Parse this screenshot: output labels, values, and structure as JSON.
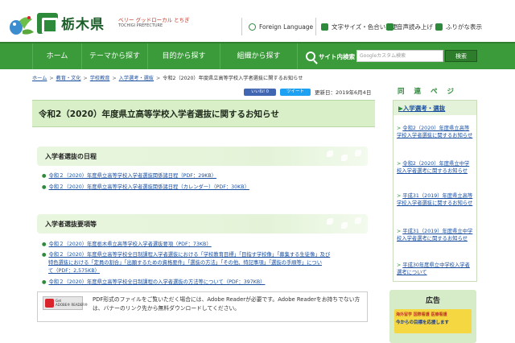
{
  "header": {
    "site_name": "栃木県",
    "tagline": "ベリー グッドローカル とちぎ",
    "tagline_en": "TOCHIGI PREFECTURE",
    "utility": [
      {
        "label": "Foreign Language",
        "icon": "globe-icon"
      },
      {
        "label": "文字サイズ・色合い変更",
        "icon": "text-size-icon"
      },
      {
        "label": "音声読み上げ",
        "icon": "speaker-icon"
      },
      {
        "label": "ふりがな表示",
        "icon": "furigana-icon"
      }
    ]
  },
  "nav": {
    "items": [
      "ホーム",
      "テーマから探す",
      "目的から探す",
      "組織から探す"
    ],
    "search_label": "サイト内検索",
    "search_placeholder": "Googleカスタム検索",
    "search_button": "検索"
  },
  "breadcrumb": [
    "ホーム",
    "教育・文化",
    "学校教育",
    "入学選考・選抜",
    "令和2（2020）年度県立高等学校入学者選抜に関するお知らせ"
  ],
  "share": {
    "like": "いいね! 0",
    "tweet": "ツイート"
  },
  "updated": "更新日：2019年6月4日",
  "page_title": "令和2（2020）年度県立高等学校入学者選抜に関するお知らせ",
  "sections": [
    {
      "heading": "入学者選抜の日程",
      "links": [
        "令和２（2020）年度県立高等学校入学者選抜関係諸日程（PDF：29KB）",
        "令和２（2020）年度県立高等学校入学者選抜関係諸日程（カレンダー）（PDF：30KB）"
      ]
    },
    {
      "heading": "入学者選抜要項等",
      "links": [
        "令和２（2020）年度栃木県立高等学校入学者選抜要項（PDF：73KB）",
        "令和２（2020）年度県立高等学校全日制課程入学者選抜における「学校教育目標」「目指す学校像」「募集する生徒像」及び",
        "特色選抜における「定員の割合」「出願するための資格要件」「選抜の方法」「その他、特記事項」「選抜の手順等」につい",
        "て（PDF：2,575KB）",
        "令和２（2020）年度県立高等学校全日制課程の入学者選抜の方法等について（PDF：397KB）"
      ]
    }
  ],
  "pdf_notice": {
    "badge_line1": "Get",
    "badge_line2": "ADOBE® READER®",
    "text": "PDF形式のファイルをご覧いただく場合には、Adobe Readerが必要です。Adobe Readerをお持ちでない方は、バナーのリンク先から無料ダウンロードしてください。"
  },
  "sidebar": {
    "letters": [
      "同",
      "連",
      "ペ",
      "ジ"
    ],
    "title": "入学選考・選抜",
    "links": [
      "令和2（2020）年度県立高等学校入学者選抜に関するお知らせ",
      "令和2（2020）年度県立中学校入学者選考に関するお知らせ",
      "平成31（2019）年度県立高等学校入学者選抜に関するお知らせ",
      "平成31（2019）年度県立中学校入学者選考に関するお知らせ",
      "平成30年度県立中学校入学者選考について"
    ]
  },
  "ad": {
    "title": "広告",
    "line1": "海外留学   国際看護 医療看護",
    "line2": "今からの目標を応援します"
  },
  "colors": {
    "brand_green": "#3b9a3a",
    "link_blue": "#1a4fa0",
    "title_bg": "#d8efc8"
  }
}
